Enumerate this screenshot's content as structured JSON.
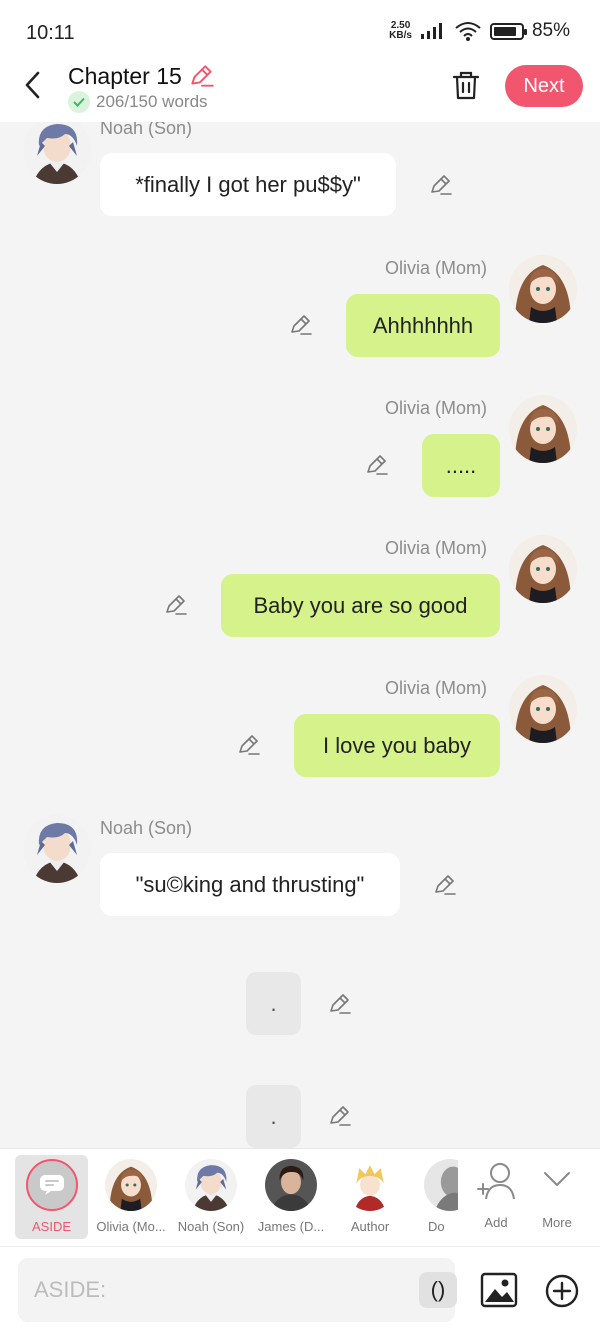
{
  "status": {
    "time": "10:11",
    "net_speed_value": "2.50",
    "net_speed_unit": "KB/s",
    "battery": "85%",
    "battery_level": 0.85
  },
  "header": {
    "title": "Chapter 15",
    "word_count": "206/150 words",
    "next_label": "Next"
  },
  "messages": [
    {
      "sender": "Noah (Son)",
      "text": "*finally I got her pu$$y\"",
      "side": "left"
    },
    {
      "sender": "Olivia (Mom)",
      "text": "Ahhhhhhh",
      "side": "right"
    },
    {
      "sender": "Olivia (Mom)",
      "text": ".....",
      "side": "right"
    },
    {
      "sender": "Olivia (Mom)",
      "text": "Baby you are so good",
      "side": "right"
    },
    {
      "sender": "Olivia (Mom)",
      "text": "I love you baby",
      "side": "right"
    },
    {
      "sender": "Noah (Son)",
      "text": "\"su©king and thrusting\"",
      "side": "left"
    },
    {
      "sender": "",
      "text": ".",
      "side": "aside"
    },
    {
      "sender": "",
      "text": ".",
      "side": "aside"
    }
  ],
  "characters": [
    {
      "label": "ASIDE",
      "selected": true
    },
    {
      "label": "Olivia (Mo..."
    },
    {
      "label": "Noah (Son)"
    },
    {
      "label": "James (D..."
    },
    {
      "label": "Author"
    },
    {
      "label": "Do"
    },
    {
      "label": "Add"
    },
    {
      "label": "More"
    }
  ],
  "input": {
    "placeholder": "ASIDE:",
    "paren_label": "()"
  },
  "colors": {
    "accent": "#f2566f",
    "bubble_green": "#d6f28b",
    "check_green": "#3dbb59"
  }
}
